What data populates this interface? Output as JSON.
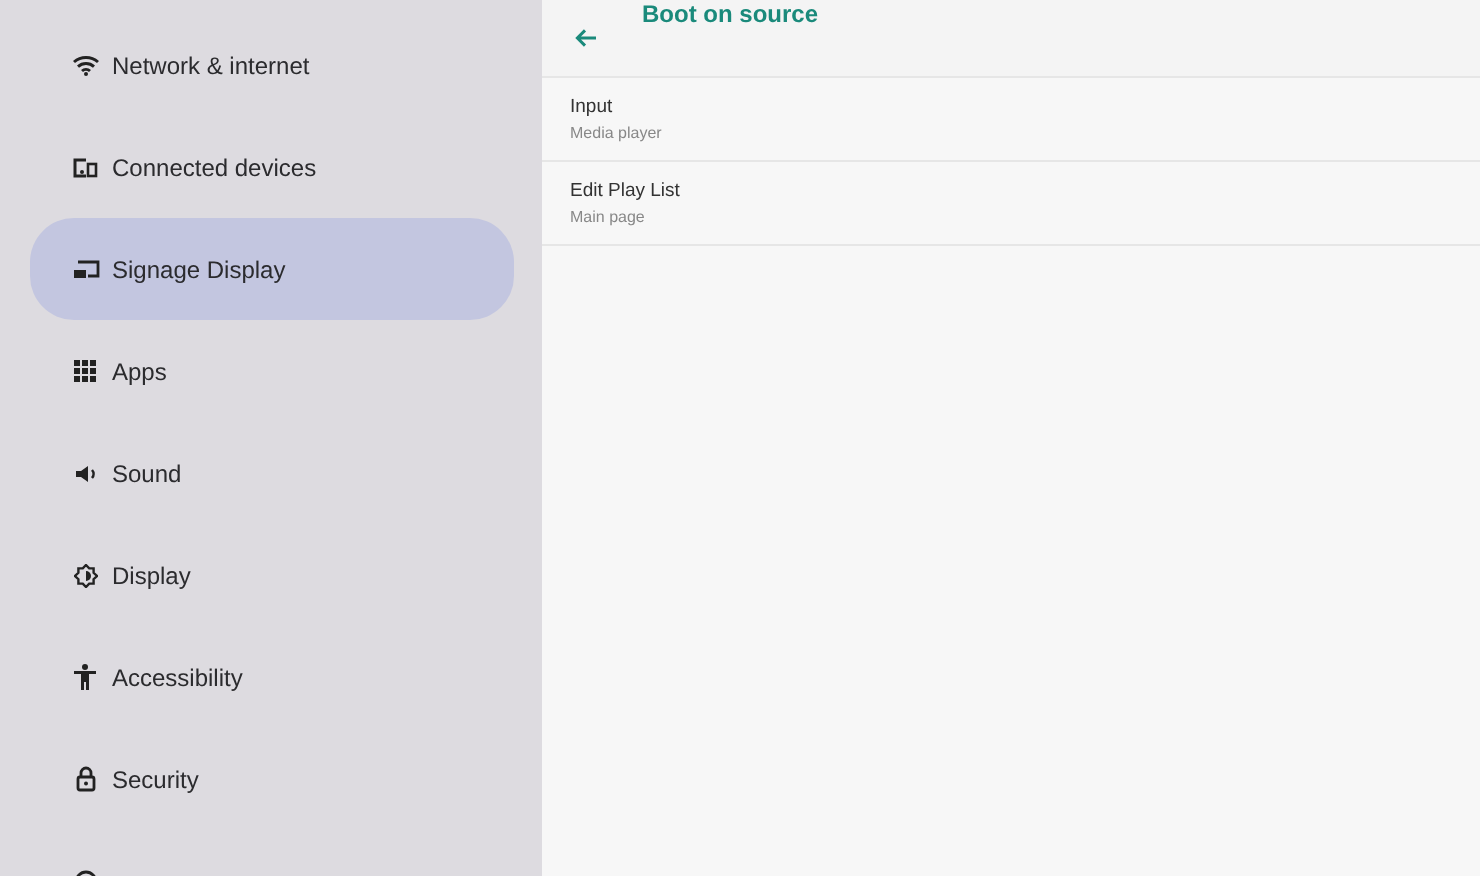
{
  "sidebar": {
    "items": [
      {
        "label": "Network & internet",
        "selected": false
      },
      {
        "label": "Connected devices",
        "selected": false
      },
      {
        "label": "Signage Display",
        "selected": true
      },
      {
        "label": "Apps",
        "selected": false
      },
      {
        "label": "Sound",
        "selected": false
      },
      {
        "label": "Display",
        "selected": false
      },
      {
        "label": "Accessibility",
        "selected": false
      },
      {
        "label": "Security",
        "selected": false
      }
    ]
  },
  "page": {
    "title": "Boot on source",
    "rows": [
      {
        "title": "Input",
        "summary": "Media player"
      },
      {
        "title": "Edit Play List",
        "summary": "Main page"
      }
    ]
  }
}
